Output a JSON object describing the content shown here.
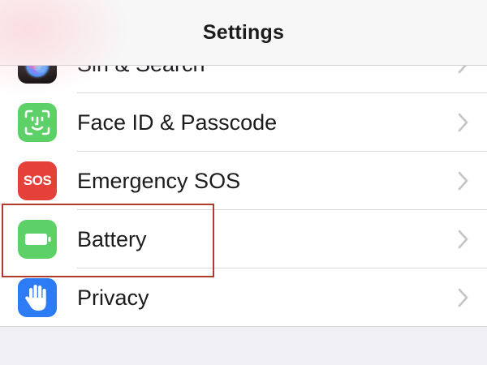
{
  "nav": {
    "title": "Settings"
  },
  "rows": [
    {
      "label": "Siri & Search",
      "icon": "siri-icon"
    },
    {
      "label": "Face ID & Passcode",
      "icon": "face-id-icon"
    },
    {
      "label": "Emergency SOS",
      "icon": "sos-icon",
      "icon_text": "SOS"
    },
    {
      "label": "Battery",
      "icon": "battery-icon"
    },
    {
      "label": "Privacy",
      "icon": "privacy-hand-icon"
    }
  ],
  "colors": {
    "green": "#5dd068",
    "red": "#e5413a",
    "blue": "#2d7cf6",
    "highlight": "#b23a2a"
  }
}
